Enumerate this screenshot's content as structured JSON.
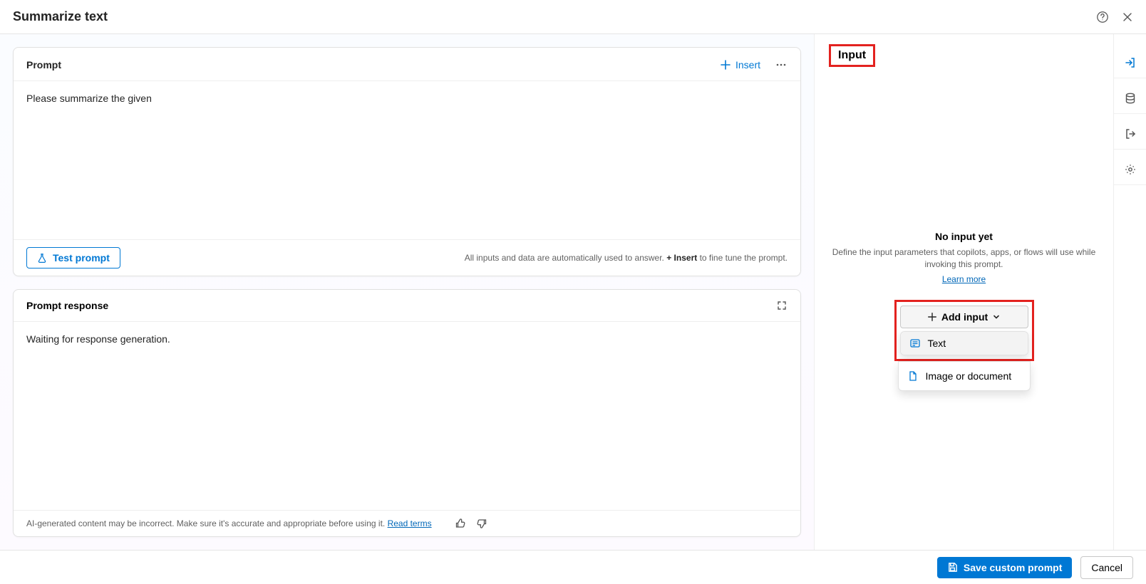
{
  "header": {
    "title": "Summarize text"
  },
  "prompt_card": {
    "title": "Prompt",
    "insert_label": "Insert",
    "content": "Please summarize the given",
    "test_label": "Test prompt",
    "hint_prefix": "All inputs and data are automatically used to answer. ",
    "hint_bold": "+ Insert",
    "hint_suffix": " to fine tune the prompt."
  },
  "response_card": {
    "title": "Prompt response",
    "body": "Waiting for response generation.",
    "disclaimer": "AI-generated content may be incorrect. Make sure it's accurate and appropriate before using it. ",
    "read_terms": "Read terms"
  },
  "right_panel": {
    "tab_label": "Input",
    "empty_title": "No input yet",
    "empty_desc": "Define the input parameters that copilots, apps, or flows will use while invoking this prompt.",
    "learn_more": "Learn more",
    "add_input_label": "Add input",
    "menu": {
      "text": "Text",
      "image": "Image or document"
    }
  },
  "footer": {
    "save": "Save custom prompt",
    "cancel": "Cancel"
  }
}
